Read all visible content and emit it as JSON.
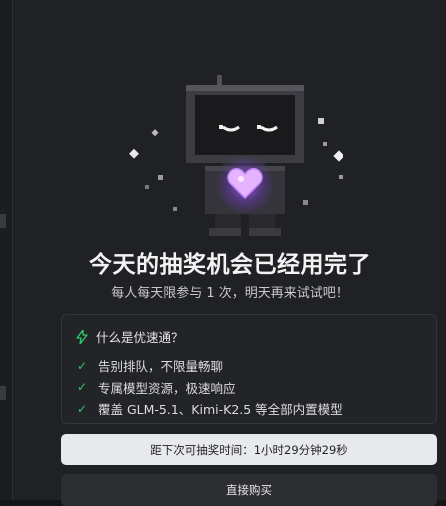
{
  "dialog": {
    "title": "今天的抽奖机会已经用完了",
    "subtitle": "每人每天限参与 1 次，明天再来试试吧！"
  },
  "info": {
    "heading": "什么是优速通？",
    "items": [
      "告别排队，不限量畅聊",
      "专属模型资源，极速响应",
      "覆盖 GLM-5.1、Kimi-K2.5 等全部内置模型"
    ]
  },
  "countdown": {
    "label": "距下次可抽奖时间：1小时29分钟29秒"
  },
  "buy_button": {
    "label": "直接购买"
  },
  "colors": {
    "accent_green": "#2ecc71",
    "heart": "#e0a8ff",
    "modal_bg": "#202124"
  },
  "icons": {
    "mascot": "sleepy-robot-with-heart-icon",
    "info_heading": "lightning-bolt-icon",
    "item_marker": "check-icon"
  }
}
